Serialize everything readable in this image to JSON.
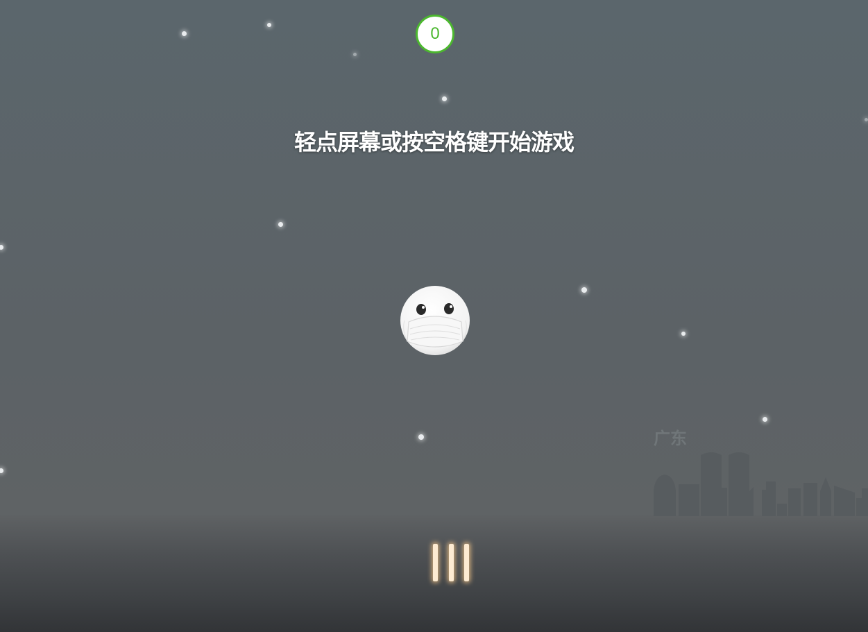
{
  "hud": {
    "score": "0",
    "score_color": "#4cb82f"
  },
  "prompt": {
    "start_text": "轻点屏幕或按空格键开始游戏"
  },
  "scene": {
    "city_label": "广东",
    "player_icon": "masked-face-icon",
    "pause_icon": "pause-bars-icon"
  },
  "colors": {
    "sky": "#5b666c",
    "ground": "#3f4245",
    "skyline": "#575c5f",
    "pause_bar": "#fdebd2"
  }
}
